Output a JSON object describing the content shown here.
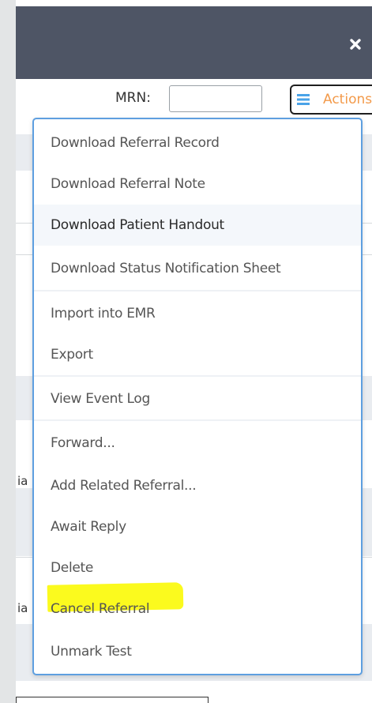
{
  "toolbar": {
    "mrn_label": "MRN:",
    "mrn_value": "",
    "actions_label": "Actions"
  },
  "background": {
    "fragment_1": "ia",
    "fragment_2": "ia"
  },
  "menu": {
    "items": [
      {
        "label": "Download Referral Record"
      },
      {
        "label": "Download Referral Note"
      },
      {
        "label": "Download Patient Handout"
      },
      {
        "label": "Download Status Notification Sheet"
      },
      {
        "label": "Import into EMR"
      },
      {
        "label": "Export"
      },
      {
        "label": "View Event Log"
      },
      {
        "label": "Forward..."
      },
      {
        "label": "Add Related Referral..."
      },
      {
        "label": "Await Reply"
      },
      {
        "label": "Delete"
      },
      {
        "label": "Cancel Referral"
      },
      {
        "label": "Unmark Test"
      }
    ]
  },
  "colors": {
    "titlebar": "#4e5565",
    "menu_border": "#5e9fe0",
    "actions_text": "#f39a4a",
    "highlight": "#fbfa1e"
  },
  "icons": {
    "close": "close-icon",
    "menu": "hamburger-icon"
  }
}
